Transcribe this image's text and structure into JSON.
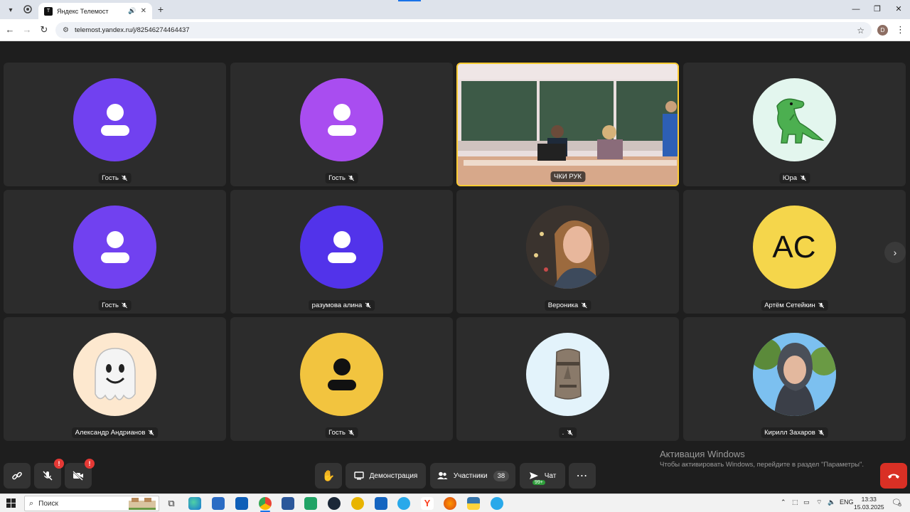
{
  "browser": {
    "tab_title": "Яндекс Телемост",
    "url": "telemost.yandex.ru/j/82546274464437",
    "profile_initial": "D"
  },
  "tiles": [
    {
      "name": "Гость",
      "kind": "placeholder",
      "color": "#7141f0"
    },
    {
      "name": "Гость",
      "kind": "placeholder",
      "color": "#a94df0"
    },
    {
      "name": "ЧКИ РУК",
      "kind": "video"
    },
    {
      "name": "Юра",
      "kind": "dino",
      "color": "#e3f6ee"
    },
    {
      "name": "Гость",
      "kind": "placeholder",
      "color": "#7141f0"
    },
    {
      "name": "разумова алина",
      "kind": "placeholder",
      "color": "#5233ea"
    },
    {
      "name": "Вероника",
      "kind": "photo"
    },
    {
      "name": "Артём Сетейкин",
      "kind": "initials",
      "initials": "АС",
      "color": "#f5d64b"
    },
    {
      "name": "Александр Андрианов",
      "kind": "ghost",
      "color": "#fde8cf"
    },
    {
      "name": "Гость",
      "kind": "placeholder-dark",
      "color": "#f2c43f"
    },
    {
      "name": ".",
      "kind": "moai",
      "color": "#e3f3fb"
    },
    {
      "name": "Кирилл Захаров",
      "kind": "photo2"
    }
  ],
  "controls": {
    "demo_label": "Демонстрация",
    "participants_label": "Участники",
    "participants_count": "38",
    "chat_label": "Чат",
    "chat_badge": "99+",
    "alert_mark": "!"
  },
  "activation": {
    "title": "Активация Windows",
    "text": "Чтобы активировать Windows, перейдите в раздел \"Параметры\"."
  },
  "taskbar": {
    "search_placeholder": "Поиск",
    "lang": "ENG",
    "time": "13:33",
    "date": "15.03.2025",
    "notif_count": "5"
  }
}
